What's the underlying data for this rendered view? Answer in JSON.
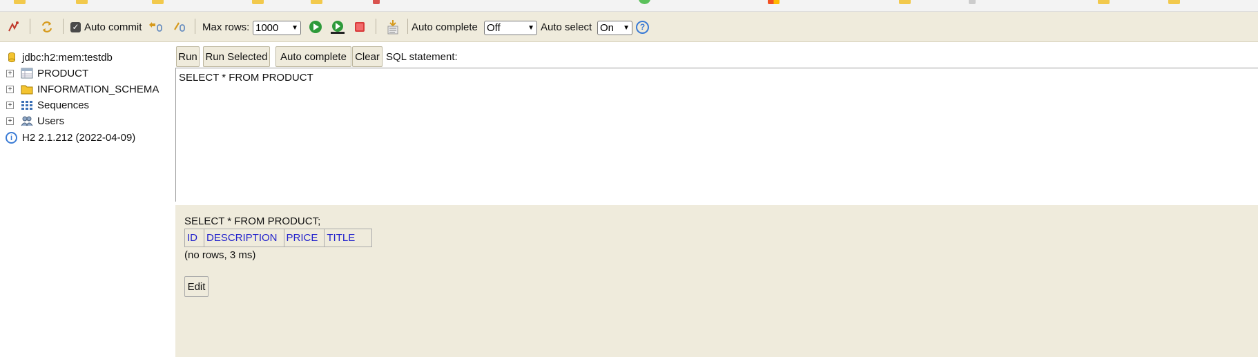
{
  "toolbar": {
    "auto_commit_label": "Auto commit",
    "auto_commit_checked": true,
    "max_rows_label": "Max rows:",
    "max_rows_value": "1000",
    "auto_complete_label": "Auto complete",
    "auto_complete_value": "Off",
    "auto_select_label": "Auto select",
    "auto_select_value": "On",
    "help_glyph": "?"
  },
  "tree": {
    "connection": "jdbc:h2:mem:testdb",
    "items": [
      {
        "label": "PRODUCT",
        "icon": "table-icon"
      },
      {
        "label": "INFORMATION_SCHEMA",
        "icon": "folder-icon"
      },
      {
        "label": "Sequences",
        "icon": "sequences-icon"
      },
      {
        "label": "Users",
        "icon": "users-icon"
      }
    ],
    "version": "H2 2.1.212 (2022-04-09)"
  },
  "query": {
    "run_label": "Run",
    "run_selected_label": "Run Selected",
    "auto_complete_label": "Auto complete",
    "clear_label": "Clear",
    "sql_statement_label": "SQL statement:",
    "editor_text": "SELECT * FROM PRODUCT"
  },
  "result": {
    "executed_sql": "SELECT * FROM PRODUCT;",
    "columns": [
      "ID",
      "DESCRIPTION",
      "PRICE",
      "TITLE"
    ],
    "info": "(no rows, 3 ms)",
    "edit_label": "Edit"
  },
  "colors": {
    "panel_bg": "#efebdc",
    "header_link": "#2222cc",
    "run_green": "#2e9a3a",
    "stop_red": "#d83b3b"
  }
}
